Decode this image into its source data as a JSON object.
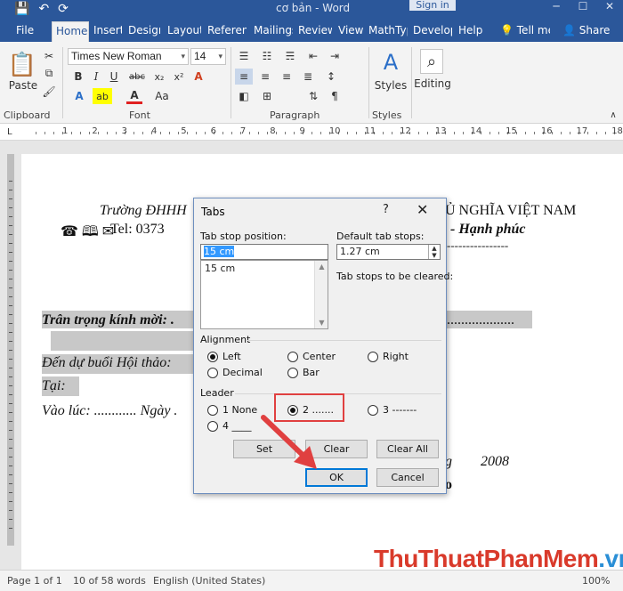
{
  "titlebar": {
    "title": "cơ bản - Word",
    "signin": "Sign in",
    "qat": [
      "💾",
      "↶",
      "⟳"
    ],
    "win": [
      "─",
      "☐",
      "✕"
    ]
  },
  "tabs": [
    "File",
    "Home",
    "Insert",
    "Design",
    "Layout",
    "References",
    "Mailings",
    "Review",
    "View",
    "MathType",
    "Developer",
    "Help",
    "Tell me",
    "Share"
  ],
  "ribbon": {
    "paste": "Paste",
    "clipboard": "Clipboard",
    "font_name": "Times New Roman",
    "font_size": "14",
    "font": "Font",
    "paragraph": "Paragraph",
    "styles_btn": "Styles",
    "styles": "Styles",
    "editing": "Editing",
    "bold": "B",
    "italic": "I",
    "underline": "U",
    "strike": "abc",
    "sub": "x₂",
    "sup": "x²",
    "font_color": "A",
    "grow": "A",
    "shrink": "A",
    "case": "Aa",
    "clear": "A",
    "highlight": "ab",
    "pilcrow": "¶"
  },
  "ruler": {
    "left": "L",
    "numbers": [
      "1",
      "2",
      "3",
      "4",
      "5",
      "6",
      "7",
      "8",
      "9",
      "10",
      "11",
      "12",
      "13",
      "14",
      "15",
      "16",
      "17",
      "18"
    ]
  },
  "doc": {
    "line1_left": "Trường ĐHHH",
    "line1_right": "Ủ NGHĨA VIỆT NAM",
    "line2_icons": "☎ 🕮 ✉",
    "line2_text": "Tel: 0373",
    "line2_right": "- Hạnh phúc",
    "dashes": "----------------",
    "invite": "Trân trọng kính mời: .",
    "invite_dots": "...................",
    "event": "Đến dự buổi Hội thảo:",
    "place": "Tại:",
    "time": "Vào lúc: ............ Ngày .",
    "date_year": "2008",
    "date_g": "g",
    "o_char": "o"
  },
  "dialog": {
    "title": "Tabs",
    "help": "?",
    "close": "✕",
    "tab_stop_label": "Tab stop position:",
    "tab_stop_value": "15 cm",
    "tab_list": [
      "15 cm"
    ],
    "default_stops_label": "Default tab stops:",
    "default_stops_value": "1.27 cm",
    "cleared_label": "Tab stops to be cleared:",
    "alignment_label": "Alignment",
    "alignment": [
      "Left",
      "Center",
      "Right",
      "Decimal",
      "Bar"
    ],
    "leader_label": "Leader",
    "leader": [
      "1 None",
      "2 .......",
      "3 -------",
      "4 ____"
    ],
    "set": "Set",
    "clear": "Clear",
    "clear_all": "Clear All",
    "ok": "OK",
    "cancel": "Cancel"
  },
  "status": {
    "page": "Page 1 of 1",
    "words": "10 of 58 words",
    "lang": "English (United States)",
    "zoom": "100%"
  },
  "watermark": {
    "part1": "ThuThuat",
    "part2": "PhanMem",
    "part3": ".vn"
  }
}
